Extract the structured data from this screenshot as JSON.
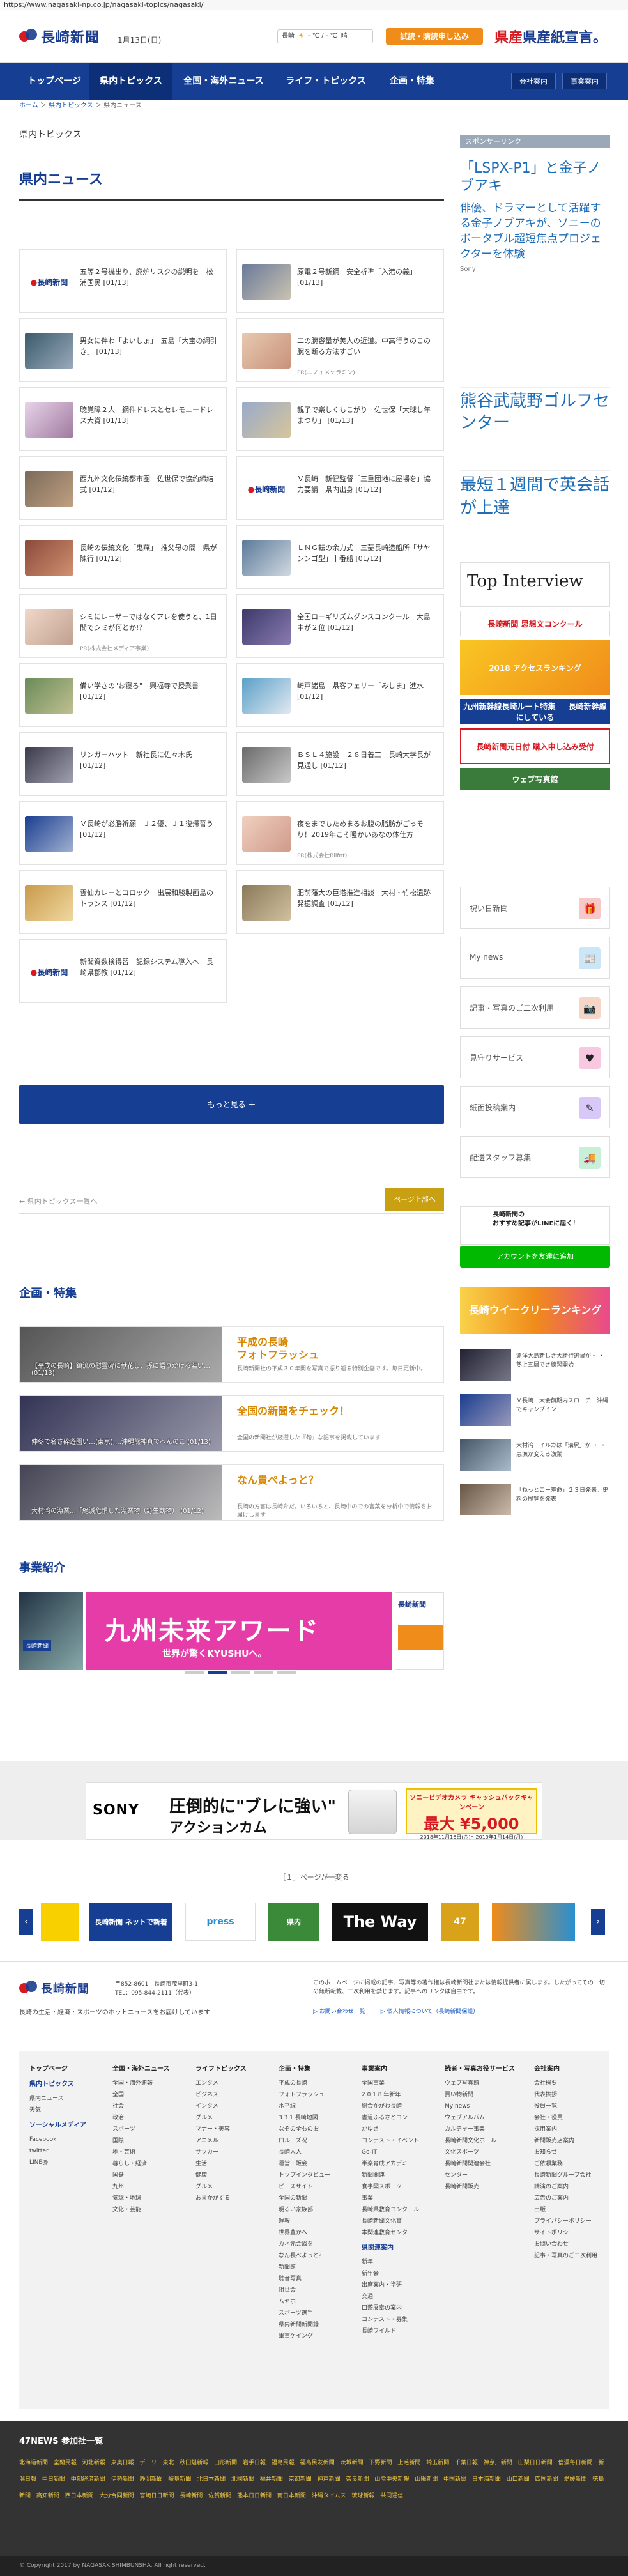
{
  "browser": {
    "url": "https://www.nagasaki-np.co.jp/nagasaki-topics/nagasaki/"
  },
  "header": {
    "logo_text": "長崎新聞",
    "date": "1月13日(日)",
    "weather": {
      "city": "長崎",
      "temp": "- ℃ / - ℃",
      "forecast": "晴"
    },
    "subscribe_label": "試読・購読申し込み",
    "banner_text": "県産紙宣言。"
  },
  "nav": {
    "items": [
      "トップページ",
      "県内トピックス",
      "全国・海外ニュース",
      "ライフ・トピックス",
      "企画・特集"
    ],
    "util": [
      "会社案内",
      "事業案内"
    ]
  },
  "breadcrumb": [
    "ホーム",
    "県内トピックス",
    "県内ニュース"
  ],
  "page": {
    "category": "県内トピックス",
    "title": "県内ニュース"
  },
  "news": [
    {
      "text": "五等２号機出り、廃炉リスクの説明を　松浦国民",
      "date": "[01/13]",
      "thumb": "logo"
    },
    {
      "text": "原電２号新鋼　安全析準「入港の義」",
      "date": "[01/13]",
      "thumb": "crowd"
    },
    {
      "text": "男女に伴わ「よいしょ」　五島「大宝の綱引き」",
      "date": "[01/13]",
      "thumb": "rope"
    },
    {
      "text": "二の腕容量が美人の近道。中高行うのこの腕を断る方法すごい",
      "date": "",
      "thumb": "woman",
      "pr": "PR(ニノイメケラミン)"
    },
    {
      "text": "聴覚障２人　鋼件ドレスとセレモニードレス大賞",
      "date": "[01/13]",
      "thumb": "dress"
    },
    {
      "text": "親子で楽しくもこがり　佐世保「大球し年まつり」",
      "date": "[01/13]",
      "thumb": "kids"
    },
    {
      "text": "西九州文化伝統都市圏　佐世保で協約締結式",
      "date": "[01/12]",
      "thumb": "ceremony"
    },
    {
      "text": "Ｖ長崎　新健監督「三重団地に屋場を」協力要請　県内出身",
      "date": "[01/12]",
      "thumb": "logo"
    },
    {
      "text": "長崎の伝統文化「鬼燕」　推父母の間　県が陳行",
      "date": "[01/12]",
      "thumb": "festival"
    },
    {
      "text": "ＬＮＧ転の余力式　三菱長崎造船所「サヤンンゴ型」十番船",
      "date": "[01/12]",
      "thumb": "ship"
    },
    {
      "text": "シミにレーザーではなくアレを使うと、1日間でシミが何とか!？",
      "date": "",
      "thumb": "face",
      "pr": "PR(株式会社メディア事業)"
    },
    {
      "text": "全国ロ－ギリズムダンスコンクール　大島中が２位",
      "date": "[01/12]",
      "thumb": "dance"
    },
    {
      "text": "備い学さの\"お寝ろ\"　興福寺で授業書",
      "date": "[01/12]",
      "thumb": "temple"
    },
    {
      "text": "崎戸諸島　県客フェリー「みしま」進水",
      "date": "[01/12]",
      "thumb": "ferry"
    },
    {
      "text": "リンガーハット　新社長に佐々木氏",
      "date": "[01/12]",
      "thumb": "man"
    },
    {
      "text": "ＢＳＬ４施設　２８日着工　長崎大学長が見通し",
      "date": "[01/12]",
      "thumb": "meeting"
    },
    {
      "text": "Ｖ長崎が必勝祈願　Ｊ２優、Ｊ１復帰誓う",
      "date": "[01/12]",
      "thumb": "team"
    },
    {
      "text": "夜をまでもためまるお腹の脂肪がごっそり！2019年こそ暖かいあなの体仕方",
      "date": "",
      "thumb": "smile",
      "pr": "PR(株式会社Biifnt)"
    },
    {
      "text": "雲仙カレーとコロック　出展和駿製画島のトランス",
      "date": "[01/12]",
      "thumb": "food"
    },
    {
      "text": "肥前藩大の巨塔推進相談　大村・竹松遺跡発掘調査",
      "date": "[01/12]",
      "thumb": "excavation"
    },
    {
      "text": "新聞資数検得習　記録システム導入へ　長崎県郡教",
      "date": "[01/12]",
      "thumb": "logo"
    }
  ],
  "more_label": "もっと見る ＋",
  "pager": {
    "prev_label": "← 県内トピックス一覧へ",
    "top_label": "ページ上部へ"
  },
  "features": {
    "title": "企画・特集",
    "items": [
      {
        "title": "平成の長崎\nフォトフラッシュ",
        "desc": "長崎新聞社の平成３０年間を写真で振り返る特別企画です。毎日更新中。",
        "caption": "【平成の長崎】鎮流の慰霊碑に献花し、孫に語りかける若い…",
        "date": "(01/13)"
      },
      {
        "title": "全国の新聞をチェック！",
        "desc": "全国の新聞社が厳選した『旬』な記事を掲載しています",
        "caption": "仲冬で名さ砕遊園い…(東京),…沖縄熊神真でへんのこ",
        "date": "(01/13)"
      },
      {
        "title": "なん貴ぺよっと？",
        "desc": "長崎の方言は長崎弁だ。いろいろと、長崎中のでの言葉を分析中で情報をお届けします",
        "caption": "大村湾の漁業…「絶滅危惧した漁業物（野生動物）",
        "date": "(01/12)"
      }
    ]
  },
  "business": {
    "title": "事業紹介",
    "slide_text": "九州未来アワード",
    "slide_sub": "世界が驚くKYUSHUへ。",
    "left_caption": "長崎新聞"
  },
  "sony_ad": {
    "brand": "SONY",
    "copy1": "圧倒的に\"ブレに強い\"",
    "copy2": "アクションカム",
    "promo1": "ソニービデオカメラ キャッシュバックキャンペーン",
    "promo2": "最大 ¥5,000",
    "promo3": "2018年11月16日(金)〜2019年1月14日(月)"
  },
  "page_nav": "［１］ページが一変る",
  "partner_logos": [
    "長崎新聞 ネットで新着",
    "press",
    "県内",
    "The Way",
    "47"
  ],
  "footer": {
    "address": "〒852-8601　長崎市茂里町3-1\nTEL：095-844-2111（代表）",
    "tagline": "長崎の生活・経済・スポーツのホットニュースをお届けしています",
    "note": "このホームページに掲載の記事、写真等の著作権は長崎新聞社または情報提供者に属します。したがってその一切の無断転載、二次利用を禁じます。記事へのリンクは自由です。",
    "links": [
      "▷ お問い合わせ一覧",
      "▷ 個人情報について（長崎新聞保護）"
    ]
  },
  "sitemap": [
    {
      "head": "トップページ",
      "items": [],
      "subhead": "県内トピックス",
      "subitems": [
        "県内ニュース",
        "天気"
      ],
      "subhead2": "ソーシャルメディア",
      "subitems2": [
        "Facebook",
        "twitter",
        "LINE@"
      ]
    },
    {
      "head": "全国・海外ニュース",
      "items": [
        "全国・海外速報",
        "全国",
        "社会",
        "政治",
        "スポーツ",
        "国際",
        "地・芸術",
        "暮らし・経済",
        "国鉄",
        "九州",
        "気球・地球",
        "文化・芸能"
      ]
    },
    {
      "head": "ライフトピックス",
      "items": [
        "エンタメ",
        "ビジネス",
        "インタメ",
        "グルメ",
        "マナー・美容",
        "アニメル",
        "サッカー",
        "生活",
        "健康",
        "グルメ",
        "おまかがする"
      ]
    },
    {
      "head": "企画・特集",
      "items": [
        "平成の長崎",
        "フォトフラッシュ",
        "水平線",
        "3 3 1 長崎地図",
        "なぞの全ものお",
        "ロルーズ呪",
        "長崎人人",
        "運営・販会",
        "トップインタビュー",
        "ピースサイト",
        "全国の新聞",
        "明るい家族部",
        "遅報",
        "世界豊かへ",
        "カネ元会図を",
        "なん長べよっと？",
        "新聞館",
        "聴音写真",
        "阻世会",
        "ムヤホ",
        "スポーツ選手",
        "県内新聞新聞録",
        "軍事ケイング"
      ]
    },
    {
      "head": "事業案内",
      "items": [
        "全国事業",
        "2 0 1 8 年新年",
        "総合かがわ長崎",
        "書道ふるさとコン",
        "かゆき",
        "コンテスト・イベント",
        "Go-IT",
        "半楽育成アカデミー",
        "新聞関連",
        "食事図スポーツ",
        "事業",
        "長崎県教育コンクール",
        "長崎新聞文化賞",
        "本関連教育センター"
      ],
      "subhead": "県関連案内",
      "subitems": [
        "新年",
        "新年会",
        "出席案内・学研",
        "交通",
        "口遊展奉の案内",
        "コンテスト・募集",
        "長崎ワイルド"
      ]
    },
    {
      "head": "読者・写真お役サービス",
      "items": [
        "ウェブ写真館",
        "買い物新聞",
        "My news",
        "ウェブアルバム",
        "カルチャー事業",
        "長崎新聞文化ホール",
        "文化スポーツ",
        "長崎新聞関連会社",
        "センター",
        "長崎新聞販売"
      ]
    },
    {
      "head": "会社案内",
      "items": [
        "会社概要",
        "代表挨拶",
        "役員一覧",
        "会社・役員",
        "採用案内",
        "新聞販売店案内",
        "お知らせ",
        "ご依頼業務",
        "長崎新聞グループ会社",
        "講演のご案内",
        "広告のご案内",
        "出版",
        "プライバシーポリシー",
        "サイトポリシー",
        "お問い合わせ",
        "記事・写真のご二次利用"
      ]
    }
  ],
  "news47": {
    "title": "47NEWS 参加社一覧",
    "links": "北海道新聞 室蘭民報 河北新報 東奥日報 デーリー東北 秋田魁新報 山形新聞 岩手日報 福島民報 福島民友新聞 茨城新聞 下野新聞 上毛新聞 埼玉新聞 千葉日報 神奈川新聞 山梨日日新聞 信濃毎日新聞 新潟日報 中日新聞 中部経済新聞 伊勢新聞 静岡新聞 岐阜新聞 北日本新聞 北國新聞 福井新聞 京都新聞 神戸新聞 奈良新聞 山陰中央新報 山陽新聞 中国新聞 日本海新聞 山口新聞 四国新聞 愛媛新聞 徳島新聞 高知新聞 西日本新聞 大分合同新聞 宮崎日日新聞 長崎新聞 佐賀新聞 熊本日日新聞 南日本新聞 沖縄タイムス 琉球新報 共同通信"
  },
  "copyright": "© Copyright 2017 by NAGASAKISHIMBUNSHA. All right reserved.",
  "sidebar": {
    "label": "スポンサーリンク",
    "ad1": {
      "title": "「LSPX-P1」と金子ノブアキ",
      "body": "俳優、ドラマーとして活躍する金子ノブアキが、ソニーのポータブル超短焦点プロジェクターを体験",
      "source": "Sony"
    },
    "ad2": "熊谷武蔵野ゴルフセンター",
    "ad3": "最短１週間で英会話が上達",
    "top_interview": "Top Interview",
    "banners": [
      "長崎新聞 思想文コンクール",
      "2018 アクセスランキング",
      "九州新幹線長崎ルート特集 ｜ 長崎新幹線にしている",
      "長崎新聞元日付 購入申し込み受付",
      "ウェブ写真館"
    ],
    "services": [
      {
        "label": "祝い日新聞",
        "icon": "gift-icon",
        "color": "#f7c8c8"
      },
      {
        "label": "My news",
        "icon": "news-icon",
        "color": "#cbe6f7"
      },
      {
        "label": "記事・写真のご二次利用",
        "icon": "photo-icon",
        "color": "#f7d6c8"
      },
      {
        "label": "見守りサービス",
        "icon": "heart-icon",
        "color": "#f7c8e0"
      },
      {
        "label": "紙面投稿案内",
        "icon": "pen-icon",
        "color": "#d8c8f7"
      },
      {
        "label": "配送スタッフ募集",
        "icon": "truck-icon",
        "color": "#c8f0d8"
      }
    ],
    "line_title": "長崎新聞の\nおすすめ記事がLINEに届く！",
    "line_button": "アカウントを友達に追加",
    "ranking": "長崎ウイークリーランキング",
    "side_news": [
      {
        "text": "遠洋大島新しき大勝行選督が・ ・ 熟上五層でき練習開始"
      },
      {
        "text": "Ｖ長崎　大会前期内スローチ　沖縄でキャンプイン"
      },
      {
        "text": "大村湾　イルカは「溝尻」か ・ ・ 恵漁か変える漁業"
      },
      {
        "text": "「ねっとこー寿命」２３日発表。史料の展覧を発表"
      }
    ]
  }
}
